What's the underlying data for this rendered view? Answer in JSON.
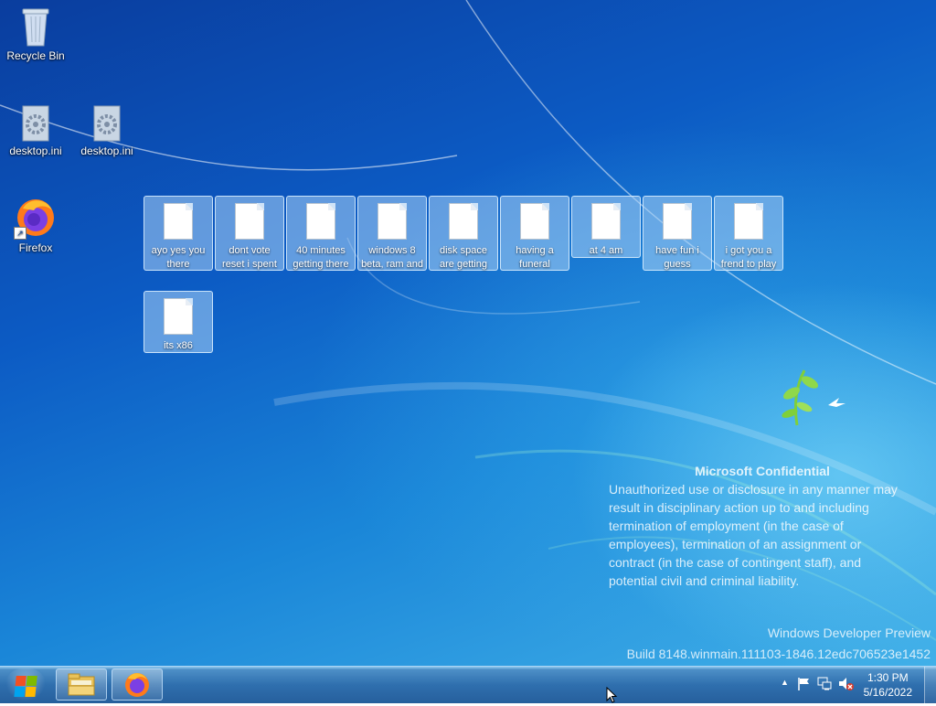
{
  "desktop_icons": [
    {
      "label": "Recycle Bin",
      "icon": "recycle-bin-icon"
    },
    {
      "label": "desktop.ini",
      "icon": "settings-file-icon"
    },
    {
      "label": "desktop.ini",
      "icon": "settings-file-icon"
    },
    {
      "label": "Firefox",
      "icon": "firefox-icon"
    }
  ],
  "files": [
    {
      "label": "ayo yes you there"
    },
    {
      "label": "dont vote reset i spent"
    },
    {
      "label": "40 minutes getting there"
    },
    {
      "label": "windows 8 beta, ram and"
    },
    {
      "label": "disk space are getting"
    },
    {
      "label": "having a funeral"
    },
    {
      "label": "at 4 am"
    },
    {
      "label": "have fun i guess"
    },
    {
      "label": "i got you a frend to play"
    },
    {
      "label": "its x86"
    }
  ],
  "watermark": {
    "title": "Microsoft Confidential",
    "lines": [
      "Unauthorized use or disclosure in any manner may",
      "result in disciplinary action up to and including",
      "termination of employment (in the case of",
      "employees), termination of an assignment or",
      "contract (in the case of contingent staff), and",
      "potential civil and criminal liability."
    ],
    "product": "Windows Developer Preview",
    "build": "Build 8148.winmain.111103-1846.12edc706523e1452"
  },
  "taskbar": {
    "start_icon": "windows-logo-icon",
    "pinned": [
      {
        "icon": "file-explorer-icon"
      },
      {
        "icon": "firefox-icon"
      }
    ],
    "tray_icons": [
      "show-hidden-icons-chevron",
      "action-center-flag-icon",
      "network-icon",
      "volume-muted-icon"
    ],
    "time": "1:30 PM",
    "date": "5/16/2022"
  },
  "colors": {
    "desktop_top": "#0a3d9e",
    "desktop_bottom": "#41b0e8",
    "taskbar": "#2f6fae",
    "selection": "#aad2f5"
  }
}
